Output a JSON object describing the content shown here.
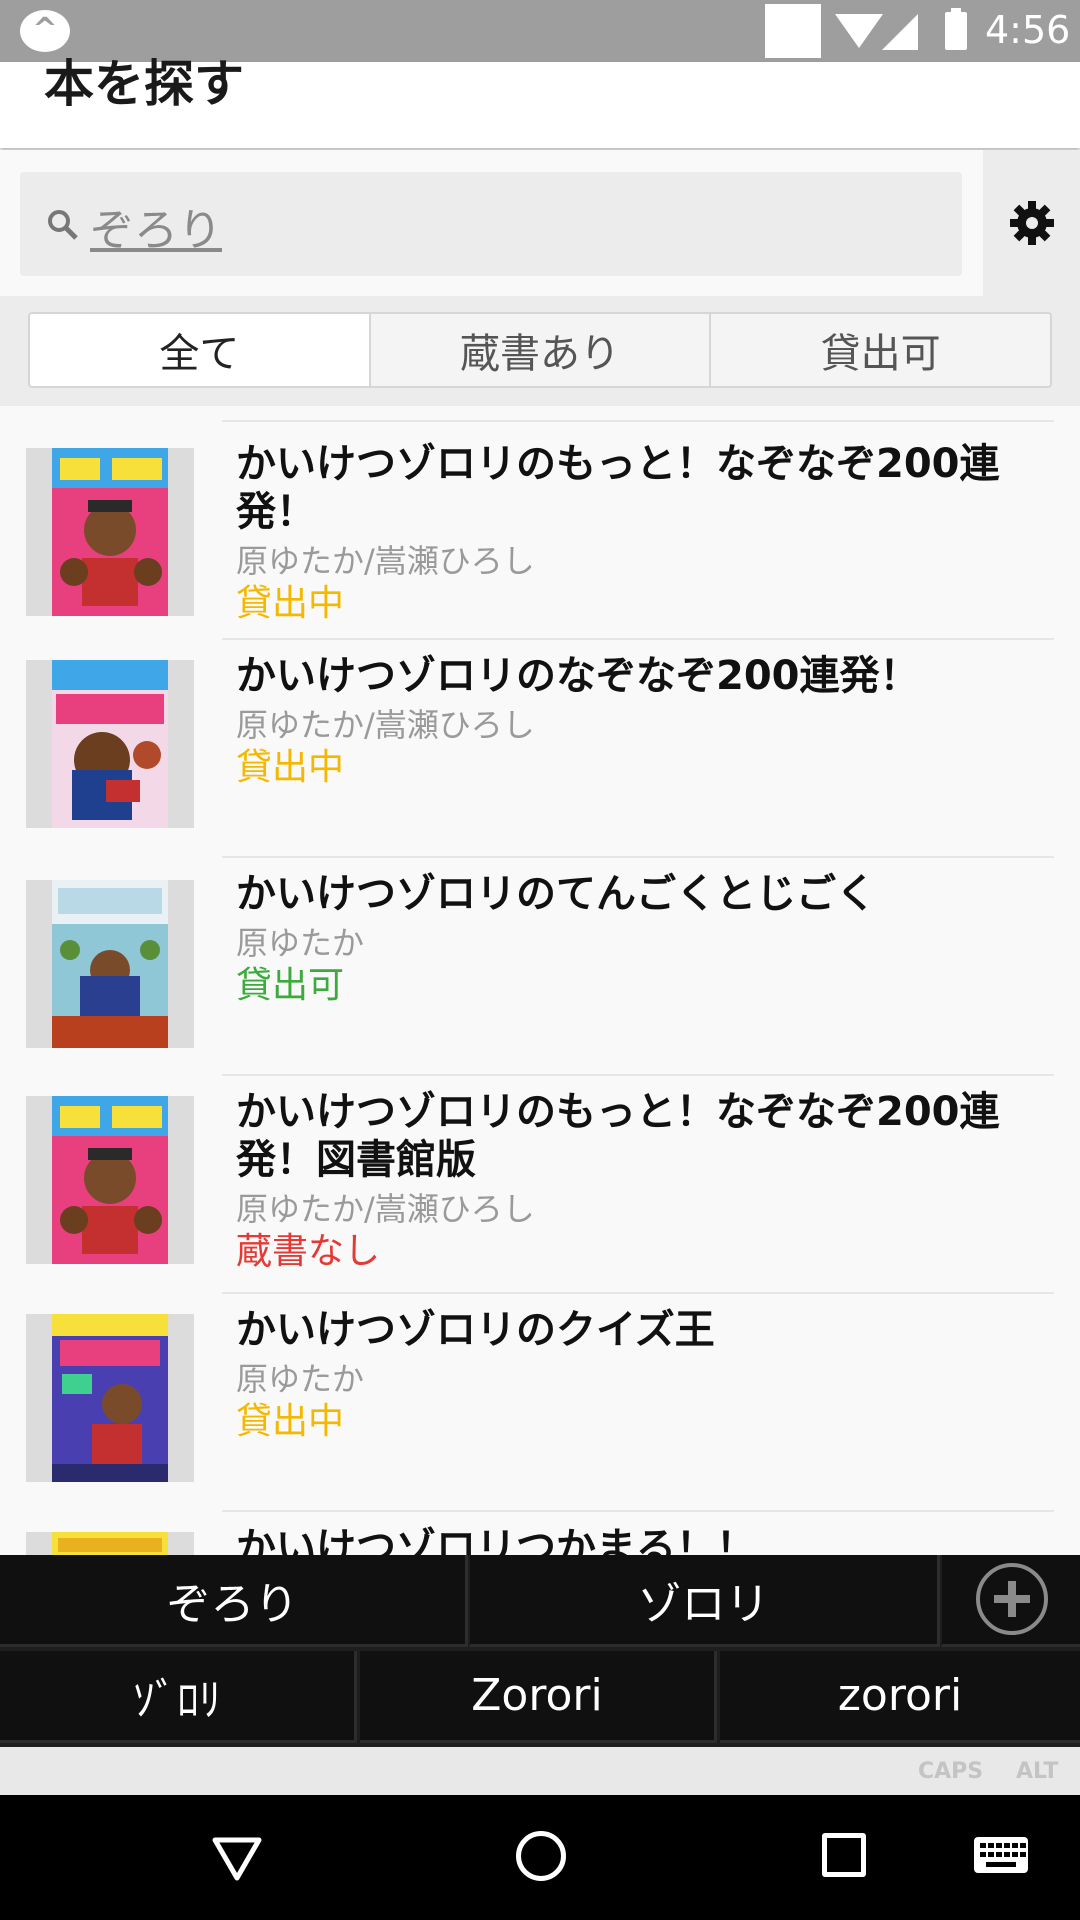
{
  "status_bar": {
    "time": "4:56"
  },
  "app_bar": {
    "title": "本を探す"
  },
  "search": {
    "query": "ぞろり"
  },
  "tabs": [
    {
      "label": "全て",
      "selected": true
    },
    {
      "label": "蔵書あり",
      "selected": false
    },
    {
      "label": "貸出可",
      "selected": false
    }
  ],
  "books": [
    {
      "title": "かいけつゾロリのもっと！なぞなぞ200連発！",
      "author": "原ゆたか/嵩瀬ひろし",
      "status": "貸出中",
      "status_color": "#f5b800"
    },
    {
      "title": "かいけつゾロリのなぞなぞ200連発！",
      "author": "原ゆたか/嵩瀬ひろし",
      "status": "貸出中",
      "status_color": "#f5b800"
    },
    {
      "title": "かいけつゾロリのてんごくとじごく",
      "author": "原ゆたか",
      "status": "貸出可",
      "status_color": "#3caa3c"
    },
    {
      "title": "かいけつゾロリのもっと！なぞなぞ200連発！図書館版",
      "author": "原ゆたか/嵩瀬ひろし",
      "status": "蔵書なし",
      "status_color": "#e53935"
    },
    {
      "title": "かいけつゾロリのクイズ王",
      "author": "原ゆたか",
      "status": "貸出中",
      "status_color": "#f5b800"
    },
    {
      "title": "かいけつゾロリつかまる！！",
      "author": "",
      "status": ""
    }
  ],
  "ime": {
    "candidates_row1": [
      "ぞろり",
      "ゾロリ"
    ],
    "candidates_row2": [
      "ｿﾞﾛﾘ",
      "Zorori",
      "zorori"
    ],
    "modifiers": [
      "CAPS",
      "ALT"
    ]
  },
  "nav_bar": {
    "icons": [
      "back-icon",
      "home-icon",
      "recents-icon",
      "keyboard-icon"
    ]
  }
}
